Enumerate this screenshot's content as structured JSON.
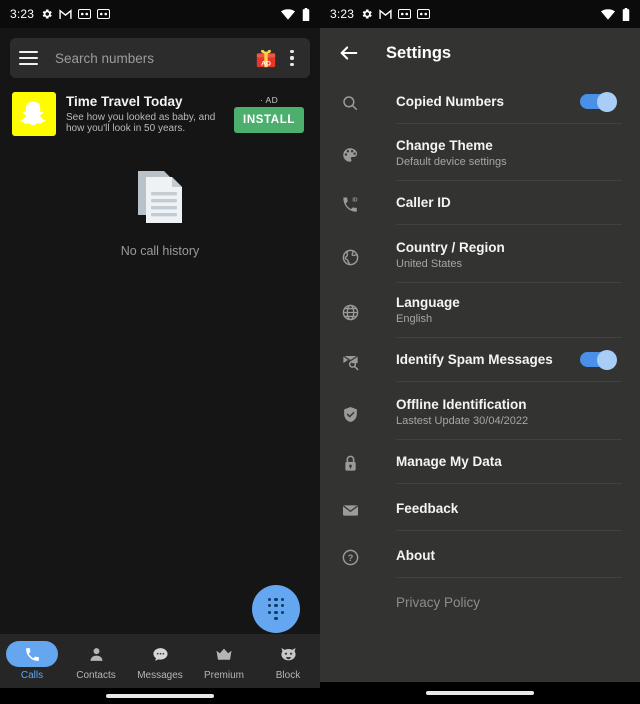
{
  "colors": {
    "left_bg": "#151515",
    "right_bg": "#333331",
    "accent_blue": "#64a6f0",
    "toggle_on": "#4a90e8",
    "install_green": "#4CAF6E",
    "snap_yellow": "#FFFC00",
    "gift_red": "#e8372a",
    "divider": "#414140"
  },
  "status_bar": {
    "time": "3:23",
    "left_icons": [
      "gear-icon",
      "gmail-icon",
      "dual-sim-icon",
      "dual-sim-icon"
    ],
    "right_icons": [
      "wifi-icon",
      "battery-icon"
    ]
  },
  "calls_screen": {
    "search": {
      "menu_icon": "hamburger-icon",
      "placeholder": "Search numbers",
      "gift_icon": "gift-ad-icon",
      "gift_badge": "AD",
      "overflow_icon": "kebab-menu-icon"
    },
    "ad": {
      "app_icon": "snapchat-ghost-icon",
      "title": "Time Travel Today",
      "description": "See how you looked as baby, and how you'll look in 50 years.",
      "ad_flag": "AD",
      "ad_flag_dot": "·",
      "install_label": "INSTALL"
    },
    "empty_state": {
      "icon": "documents-icon",
      "label": "No call history"
    },
    "fab": {
      "icon": "dialpad-icon"
    },
    "bottom_nav": [
      {
        "label": "Calls",
        "icon": "phone-icon",
        "active": true
      },
      {
        "label": "Contacts",
        "icon": "person-icon",
        "active": false
      },
      {
        "label": "Messages",
        "icon": "chat-bubble-icon",
        "active": false
      },
      {
        "label": "Premium",
        "icon": "crown-icon",
        "active": false
      },
      {
        "label": "Block",
        "icon": "devil-face-icon",
        "active": false
      }
    ]
  },
  "settings_screen": {
    "appbar": {
      "back_icon": "back-arrow-icon",
      "title": "Settings"
    },
    "items": [
      {
        "title": "Copied Numbers",
        "subtitle": "",
        "icon": "search-icon",
        "toggle": true
      },
      {
        "title": "Change Theme",
        "subtitle": "Default device settings",
        "icon": "palette-icon",
        "toggle": null
      },
      {
        "title": "Caller ID",
        "subtitle": "",
        "icon": "phone-id-icon",
        "toggle": null
      },
      {
        "title": "Country / Region",
        "subtitle": "United States",
        "icon": "globe-icon",
        "toggle": null
      },
      {
        "title": "Language",
        "subtitle": "English",
        "icon": "globe-grid-icon",
        "toggle": null
      },
      {
        "title": "Identify Spam Messages",
        "subtitle": "",
        "icon": "envelope-search-icon",
        "toggle": true
      },
      {
        "title": "Offline Identification",
        "subtitle": "Lastest Update 30/04/2022",
        "icon": "shield-check-icon",
        "toggle": null
      },
      {
        "title": "Manage My Data",
        "subtitle": "",
        "icon": "lock-icon",
        "toggle": null
      },
      {
        "title": "Feedback",
        "subtitle": "",
        "icon": "envelope-icon",
        "toggle": null
      },
      {
        "title": "About",
        "subtitle": "",
        "icon": "question-circle-icon",
        "toggle": null
      },
      {
        "title": "Privacy Policy",
        "subtitle": "",
        "icon": "",
        "toggle": null
      }
    ]
  }
}
